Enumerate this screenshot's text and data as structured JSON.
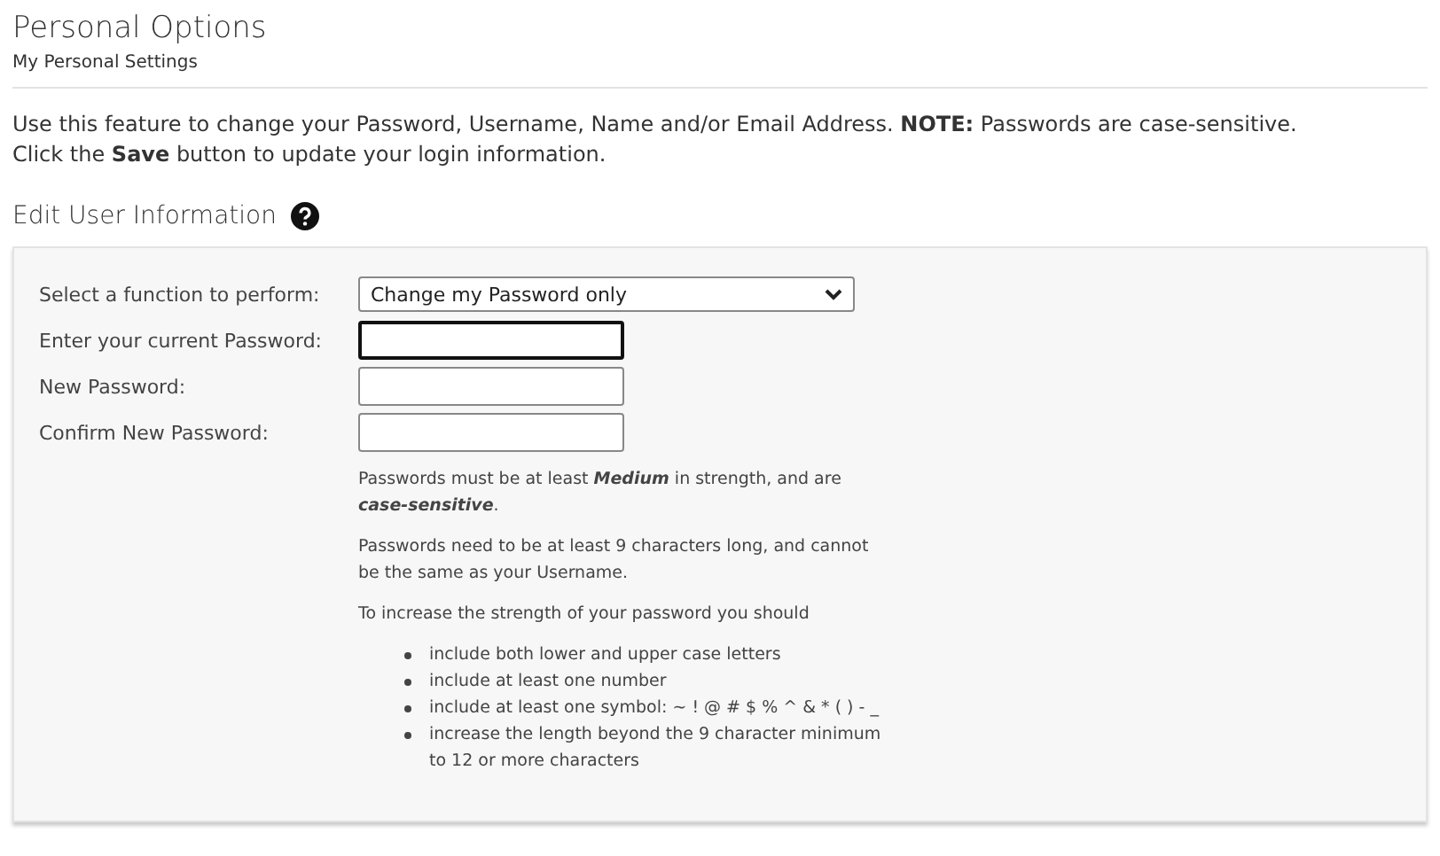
{
  "header": {
    "title": "Personal Options",
    "subtitle": "My Personal Settings"
  },
  "intro": [
    "Use this feature to change your Password, Username, Name and/or Email Address. **NOTE:** Passwords are case-sensitive.",
    "Click the **Save** button to update your login information."
  ],
  "section": {
    "title": "Edit User Information"
  },
  "form": {
    "rows": [
      {
        "kind": "select",
        "label": "Select a function to perform:",
        "value": "Change my Password only"
      },
      {
        "kind": "password",
        "label": "Enter your current Password:",
        "focused": true
      },
      {
        "kind": "password",
        "label": "New Password:",
        "focused": false
      },
      {
        "kind": "password",
        "label": "Confirm New Password:",
        "focused": false
      }
    ],
    "help": [
      "Passwords must be at least *Medium* in strength, and are *case-sensitive*.",
      "Passwords need to be at least 9 characters long, and cannot be the same as your Username.",
      "To increase the strength of your password you should"
    ],
    "tips": [
      "include both lower and upper case letters",
      "include at least one number",
      "include at least one symbol:  ~ ! @ # $ % ^ & * ( ) - _",
      "increase the length beyond the 9 character minimum to 12 or more characters"
    ]
  }
}
